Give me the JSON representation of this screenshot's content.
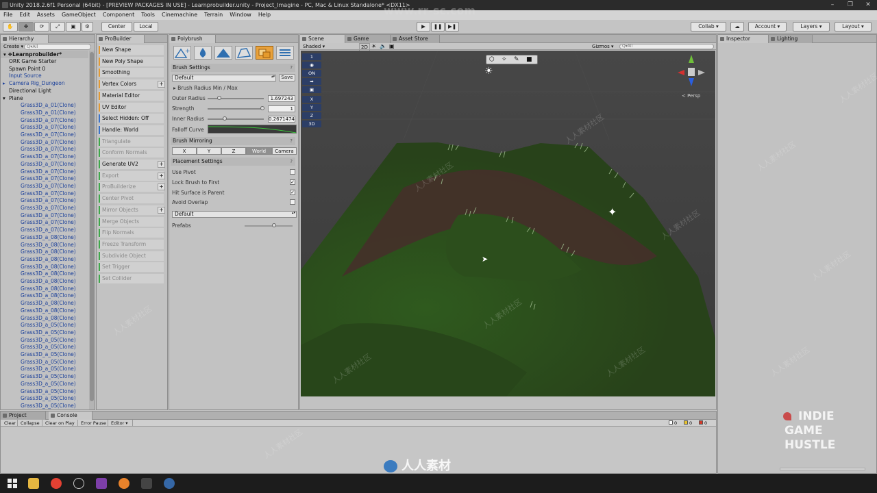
{
  "window": {
    "title": "Unity 2018.2.6f1 Personal (64bit) - [PREVIEW PACKAGES IN USE] - Learnprobuilder.unity - Project_Imagine - PC, Mac & Linux Standalone* <DX11>",
    "watermark_url": "www.rr-sc.com"
  },
  "menu": [
    "File",
    "Edit",
    "Assets",
    "GameObject",
    "Component",
    "Tools",
    "Cinemachine",
    "Terrain",
    "Window",
    "Help"
  ],
  "toolbar": {
    "pivot": "Center",
    "space": "Local",
    "collab": "Collab ▾",
    "account": "Account",
    "layers": "Layers",
    "layout": "Layout"
  },
  "hierarchy": {
    "tab": "Hierarchy",
    "create": "Create",
    "search_placeholder": "Q▾All",
    "scene": "Learnprobuilder*",
    "items": [
      {
        "label": "ORK Game Starter",
        "blue": false,
        "depth": 1
      },
      {
        "label": "Spawn Point 0",
        "blue": false,
        "depth": 1
      },
      {
        "label": "Input Source",
        "blue": true,
        "depth": 1
      },
      {
        "label": "Camera Rig_Dungeon",
        "blue": true,
        "depth": 1,
        "arrow": "▸"
      },
      {
        "label": "Directional Light",
        "blue": false,
        "depth": 1
      },
      {
        "label": "Plane",
        "blue": false,
        "depth": 1,
        "arrow": "▾"
      },
      {
        "label": "Grass3D_a_01(Clone)",
        "blue": true,
        "depth": 2
      },
      {
        "label": "Grass3D_a_01(Clone)",
        "blue": true,
        "depth": 2
      },
      {
        "label": "Grass3D_a_07(Clone)",
        "blue": true,
        "depth": 2
      },
      {
        "label": "Grass3D_a_07(Clone)",
        "blue": true,
        "depth": 2
      },
      {
        "label": "Grass3D_a_07(Clone)",
        "blue": true,
        "depth": 2
      },
      {
        "label": "Grass3D_a_07(Clone)",
        "blue": true,
        "depth": 2
      },
      {
        "label": "Grass3D_a_07(Clone)",
        "blue": true,
        "depth": 2
      },
      {
        "label": "Grass3D_a_07(Clone)",
        "blue": true,
        "depth": 2
      },
      {
        "label": "Grass3D_a_07(Clone)",
        "blue": true,
        "depth": 2
      },
      {
        "label": "Grass3D_a_07(Clone)",
        "blue": true,
        "depth": 2
      },
      {
        "label": "Grass3D_a_07(Clone)",
        "blue": true,
        "depth": 2
      },
      {
        "label": "Grass3D_a_07(Clone)",
        "blue": true,
        "depth": 2
      },
      {
        "label": "Grass3D_a_07(Clone)",
        "blue": true,
        "depth": 2
      },
      {
        "label": "Grass3D_a_07(Clone)",
        "blue": true,
        "depth": 2
      },
      {
        "label": "Grass3D_a_07(Clone)",
        "blue": true,
        "depth": 2
      },
      {
        "label": "Grass3D_a_07(Clone)",
        "blue": true,
        "depth": 2
      },
      {
        "label": "Grass3D_a_07(Clone)",
        "blue": true,
        "depth": 2
      },
      {
        "label": "Grass3D_a_07(Clone)",
        "blue": true,
        "depth": 2
      },
      {
        "label": "Grass3D_a_08(Clone)",
        "blue": true,
        "depth": 2
      },
      {
        "label": "Grass3D_a_08(Clone)",
        "blue": true,
        "depth": 2
      },
      {
        "label": "Grass3D_a_08(Clone)",
        "blue": true,
        "depth": 2
      },
      {
        "label": "Grass3D_a_08(Clone)",
        "blue": true,
        "depth": 2
      },
      {
        "label": "Grass3D_a_08(Clone)",
        "blue": true,
        "depth": 2
      },
      {
        "label": "Grass3D_a_08(Clone)",
        "blue": true,
        "depth": 2
      },
      {
        "label": "Grass3D_a_08(Clone)",
        "blue": true,
        "depth": 2
      },
      {
        "label": "Grass3D_a_08(Clone)",
        "blue": true,
        "depth": 2
      },
      {
        "label": "Grass3D_a_08(Clone)",
        "blue": true,
        "depth": 2
      },
      {
        "label": "Grass3D_a_08(Clone)",
        "blue": true,
        "depth": 2
      },
      {
        "label": "Grass3D_a_08(Clone)",
        "blue": true,
        "depth": 2
      },
      {
        "label": "Grass3D_a_08(Clone)",
        "blue": true,
        "depth": 2
      },
      {
        "label": "Grass3D_a_05(Clone)",
        "blue": true,
        "depth": 2
      },
      {
        "label": "Grass3D_a_05(Clone)",
        "blue": true,
        "depth": 2
      },
      {
        "label": "Grass3D_a_05(Clone)",
        "blue": true,
        "depth": 2
      },
      {
        "label": "Grass3D_a_05(Clone)",
        "blue": true,
        "depth": 2
      },
      {
        "label": "Grass3D_a_05(Clone)",
        "blue": true,
        "depth": 2
      },
      {
        "label": "Grass3D_a_05(Clone)",
        "blue": true,
        "depth": 2
      },
      {
        "label": "Grass3D_a_05(Clone)",
        "blue": true,
        "depth": 2
      },
      {
        "label": "Grass3D_a_05(Clone)",
        "blue": true,
        "depth": 2
      },
      {
        "label": "Grass3D_a_05(Clone)",
        "blue": true,
        "depth": 2
      },
      {
        "label": "Grass3D_a_05(Clone)",
        "blue": true,
        "depth": 2
      },
      {
        "label": "Grass3D_a_05(Clone)",
        "blue": true,
        "depth": 2
      },
      {
        "label": "Grass3D_a_05(Clone)",
        "blue": true,
        "depth": 2
      },
      {
        "label": "Grass3D_a_05(Clone)",
        "blue": true,
        "depth": 2
      }
    ]
  },
  "probuilder": {
    "tab": "ProBuilder",
    "items": [
      {
        "label": "New Shape",
        "color": "#e39a32",
        "enabled": true,
        "plus": false
      },
      {
        "label": "New Poly Shape",
        "color": "#e39a32",
        "enabled": true,
        "plus": false
      },
      {
        "label": "Smoothing",
        "color": "#e39a32",
        "enabled": true,
        "plus": false
      },
      {
        "label": "Vertex Colors",
        "color": "#e39a32",
        "enabled": true,
        "plus": true
      },
      {
        "label": "Material Editor",
        "color": "#e39a32",
        "enabled": true,
        "plus": false
      },
      {
        "label": "UV Editor",
        "color": "#e39a32",
        "enabled": true,
        "plus": false
      },
      {
        "label": "Select Hidden: Off",
        "color": "#3a73c9",
        "enabled": true,
        "plus": false
      },
      {
        "label": "Handle: World",
        "color": "#3a73c9",
        "enabled": true,
        "plus": false
      },
      {
        "label": "Triangulate",
        "color": "#3ea84a",
        "enabled": false,
        "plus": false
      },
      {
        "label": "Conform Normals",
        "color": "#3ea84a",
        "enabled": false,
        "plus": false
      },
      {
        "label": "Generate UV2",
        "color": "#3ea84a",
        "enabled": true,
        "plus": true
      },
      {
        "label": "Export",
        "color": "#3ea84a",
        "enabled": false,
        "plus": true
      },
      {
        "label": "ProBuilderize",
        "color": "#3ea84a",
        "enabled": false,
        "plus": true
      },
      {
        "label": "Center Pivot",
        "color": "#3ea84a",
        "enabled": false,
        "plus": false
      },
      {
        "label": "Mirror Objects",
        "color": "#3ea84a",
        "enabled": false,
        "plus": true
      },
      {
        "label": "Merge Objects",
        "color": "#3ea84a",
        "enabled": false,
        "plus": false
      },
      {
        "label": "Flip Normals",
        "color": "#3ea84a",
        "enabled": false,
        "plus": false
      },
      {
        "label": "Freeze Transform",
        "color": "#3ea84a",
        "enabled": false,
        "plus": false
      },
      {
        "label": "Subdivide Object",
        "color": "#3ea84a",
        "enabled": false,
        "plus": false
      },
      {
        "label": "Set Trigger",
        "color": "#3ea84a",
        "enabled": false,
        "plus": false
      },
      {
        "label": "Set Collider",
        "color": "#3ea84a",
        "enabled": false,
        "plus": false
      }
    ]
  },
  "polybrush": {
    "tab": "Polybrush",
    "brush_settings": "Brush Settings",
    "preset": "Default",
    "save": "Save",
    "radius_min_max": "Brush Radius Min / Max",
    "outer_radius_label": "Outer Radius",
    "outer_radius": "1.697243",
    "strength_label": "Strength",
    "strength": "1",
    "inner_radius_label": "Inner Radius",
    "inner_radius": "0.2671474",
    "falloff_label": "Falloff Curve",
    "mirroring": "Brush Mirroring",
    "axes": [
      "X",
      "Y",
      "Z"
    ],
    "world": "World",
    "camera": "Camera",
    "placement": "Placement Settings",
    "use_pivot": "Use Pivot",
    "lock_brush": "Lock Brush to First",
    "hit_surface": "Hit Surface is Parent",
    "avoid_overlap": "Avoid Overlap",
    "prefab_set": "Default",
    "prefabs": "Prefabs",
    "help": "?"
  },
  "scene": {
    "tabs": [
      "Scene",
      "Game",
      "Asset Store"
    ],
    "shaded": "Shaded",
    "two_d": "2D",
    "gizmos": "Gizmos ▾",
    "search_placeholder": "Q▾All",
    "persp": "< Persp",
    "layer_badges": [
      "1",
      "ON",
      "X",
      "Y",
      "Z",
      "3D"
    ]
  },
  "inspector": {
    "tab": "Inspector",
    "lighting_tab": "Lighting"
  },
  "bottom": {
    "project_tab": "Project",
    "console_tab": "Console",
    "buttons": [
      "Clear",
      "Collapse",
      "Clear on Play",
      "Error Pause",
      "Editor ▾"
    ],
    "counts": [
      "0",
      "0",
      "0"
    ]
  },
  "brand": {
    "line1": "INDIE",
    "line2": "GAME",
    "line3": "HUSTLE",
    "footer_cn": "人人素材"
  },
  "watermark_cn": "人人素材社区"
}
